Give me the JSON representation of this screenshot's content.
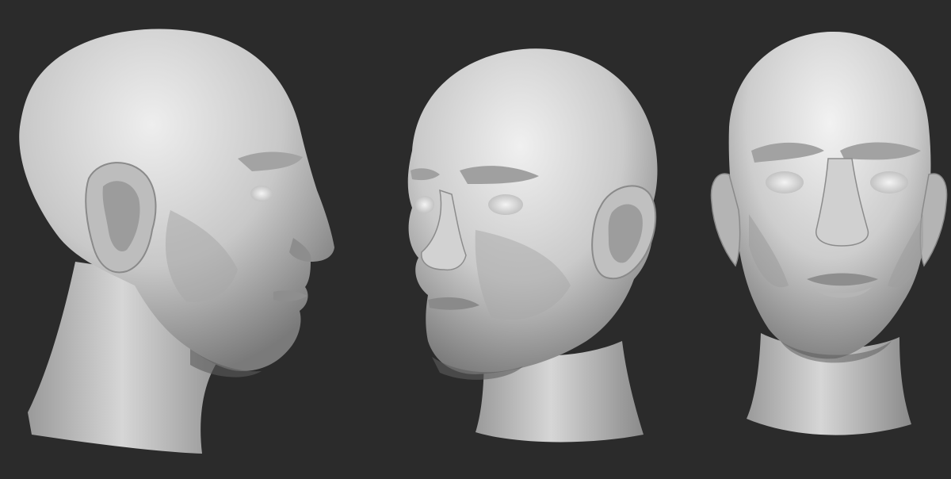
{
  "canvas": {
    "background": "#2b2b2b",
    "material_light": "#e4e4e4",
    "material_mid": "#b3b3b3",
    "material_dark": "#6e6e6e",
    "shadow": "#4a4a4a"
  },
  "scene": {
    "views": [
      {
        "name": "profile-left"
      },
      {
        "name": "three-quarter"
      },
      {
        "name": "front"
      }
    ]
  }
}
